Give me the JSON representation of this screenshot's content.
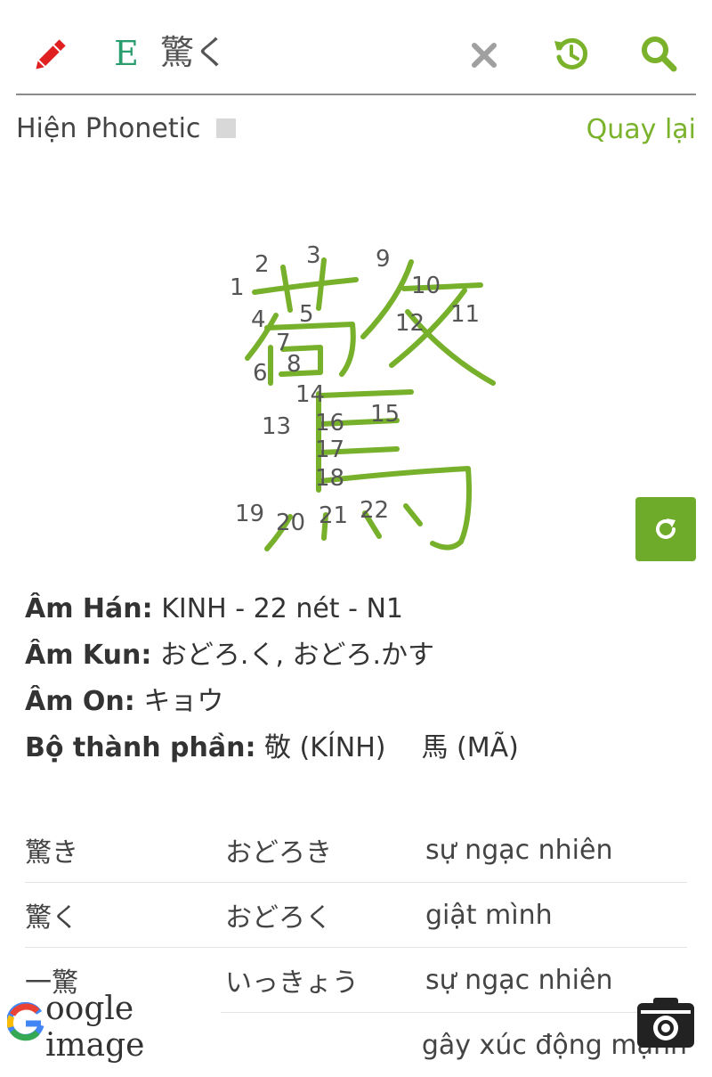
{
  "header": {
    "edit_icon": "pencil-icon",
    "lang_label": "E",
    "query": "驚く",
    "clear_icon": "close-icon",
    "history_icon": "history-icon",
    "search_icon": "search-icon"
  },
  "phonetic": {
    "label": "Hiện Phonetic",
    "checked": false
  },
  "back_label": "Quay lại",
  "kanji": {
    "character": "驚",
    "stroke_labels": [
      "1",
      "2",
      "3",
      "4",
      "5",
      "6",
      "7",
      "8",
      "9",
      "10",
      "11",
      "12",
      "13",
      "14",
      "15",
      "16",
      "17",
      "18",
      "19",
      "20",
      "21",
      "22"
    ]
  },
  "replay_icon": "refresh-icon",
  "info": {
    "han_label": "Âm Hán:",
    "han_value": "KINH - 22 nét - N1",
    "kun_label": "Âm Kun:",
    "kun_value": "おどろ.く, おどろ.かす",
    "on_label": "Âm On:",
    "on_value": "キョウ",
    "parts_label": "Bộ thành phần:",
    "part1": "敬 (KÍNH)",
    "part2": "馬 (MÃ)"
  },
  "vocab": [
    {
      "word": "驚き",
      "reading": "おどろき",
      "meaning": "sự ngạc nhiên"
    },
    {
      "word": "驚く",
      "reading": "おどろく",
      "meaning": "giật mình"
    },
    {
      "word": "一驚",
      "reading": "いっきょう",
      "meaning": "sự ngạc nhiên"
    },
    {
      "word": "",
      "reading": "",
      "meaning": "gây xúc động mạnh"
    }
  ],
  "google": {
    "letter": "G",
    "text": "oogle image"
  },
  "camera_icon": "camera-icon",
  "colors": {
    "accent": "#7ab22b",
    "stroke": "#77b02a",
    "pencil": "#e02020",
    "lang": "#2a9d6f"
  }
}
